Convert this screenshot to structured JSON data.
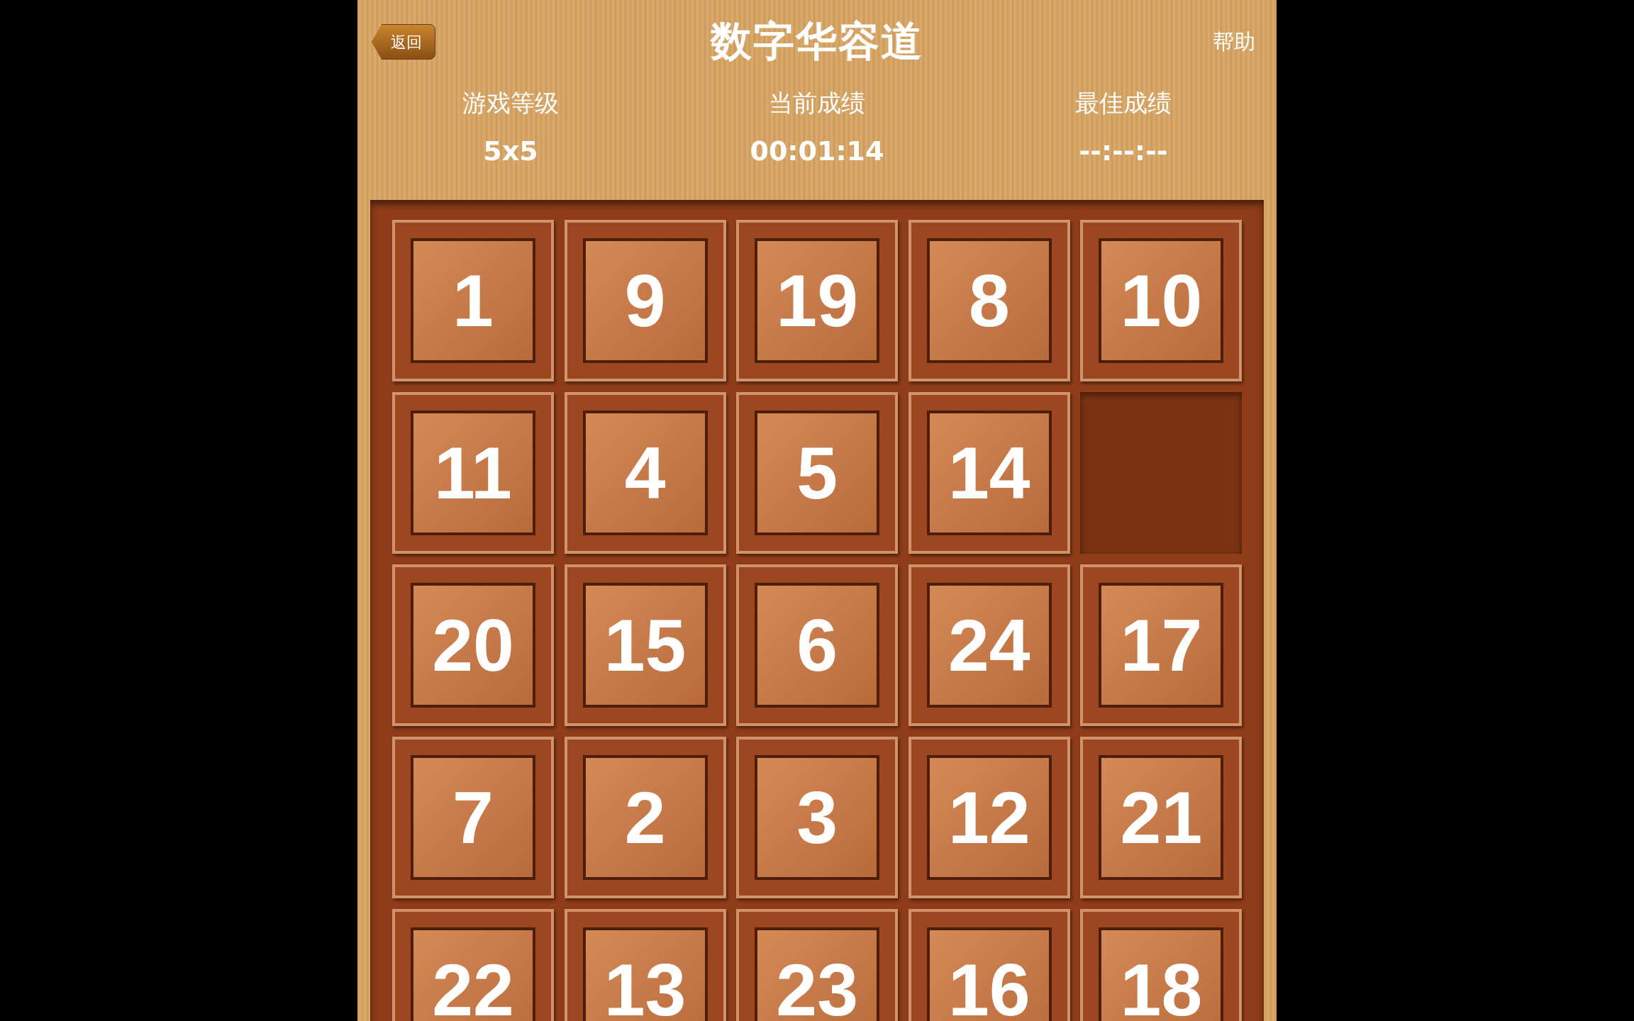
{
  "header": {
    "back_button": "返回",
    "title": "数字华容道",
    "help_button": "帮助"
  },
  "stats": [
    {
      "label": "游戏等级",
      "value": "5x5"
    },
    {
      "label": "当前成绩",
      "value": "00:01:14"
    },
    {
      "label": "最佳成绩",
      "value": "--:--:--"
    }
  ],
  "board": {
    "tiles": [
      {
        "kind": "tile",
        "number": "1"
      },
      {
        "kind": "tile",
        "number": "9"
      },
      {
        "kind": "tile",
        "number": "19"
      },
      {
        "kind": "tile",
        "number": "8"
      },
      {
        "kind": "tile",
        "number": "10"
      },
      {
        "kind": "tile",
        "number": "11"
      },
      {
        "kind": "tile",
        "number": "4"
      },
      {
        "kind": "tile",
        "number": "5"
      },
      {
        "kind": "tile",
        "number": "14"
      },
      {
        "kind": "empty"
      },
      {
        "kind": "tile",
        "number": "20"
      },
      {
        "kind": "tile",
        "number": "15"
      },
      {
        "kind": "tile",
        "number": "6"
      },
      {
        "kind": "tile",
        "number": "24"
      },
      {
        "kind": "tile",
        "number": "17"
      },
      {
        "kind": "tile",
        "number": "7"
      },
      {
        "kind": "tile",
        "number": "2"
      },
      {
        "kind": "tile",
        "number": "3"
      },
      {
        "kind": "tile",
        "number": "12"
      },
      {
        "kind": "tile",
        "number": "21"
      },
      {
        "kind": "tile",
        "number": "22"
      },
      {
        "kind": "tile",
        "number": "13"
      },
      {
        "kind": "tile",
        "number": "23"
      },
      {
        "kind": "tile",
        "number": "16"
      },
      {
        "kind": "tile",
        "number": "18"
      }
    ]
  }
}
